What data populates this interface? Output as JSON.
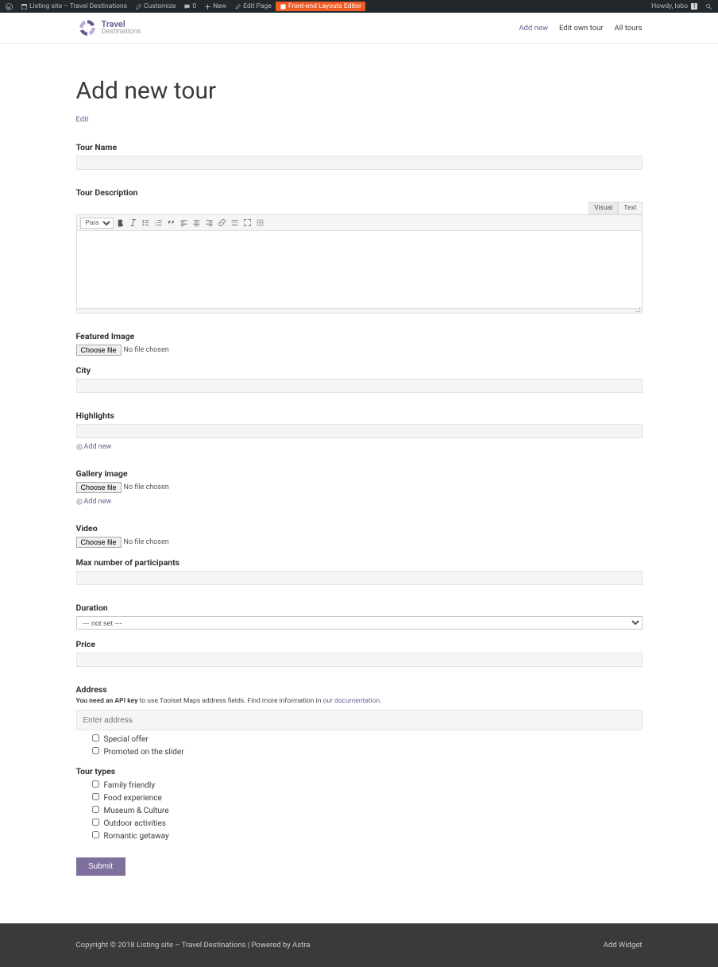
{
  "adminbar": {
    "site": "Listing site – Travel Destinations",
    "customize": "Customize",
    "comments": "0",
    "newlbl": "New",
    "editpage": "Edit Page",
    "fel": "Front-end Layouts Editor",
    "howdy": "Howdy, lobo",
    "avatar_badge": "1"
  },
  "logo": {
    "l1": "Travel",
    "l2": "Destinations"
  },
  "nav": {
    "addnew": "Add new",
    "editown": "Edit own tour",
    "alltours": "All tours"
  },
  "page": {
    "title": "Add new tour",
    "editlink": "Edit"
  },
  "labels": {
    "tourname": "Tour Name",
    "tourdesc": "Tour Description",
    "featured": "Featured Image",
    "city": "City",
    "highlights": "Highlights",
    "gallery": "Gallery image",
    "video": "Video",
    "maxpart": "Max number of participants",
    "duration": "Duration",
    "price": "Price",
    "address": "Address",
    "tourtypes": "Tour types"
  },
  "editor": {
    "tab_visual": "Visual",
    "tab_text": "Text",
    "format": "Paragraph"
  },
  "file": {
    "choose": "Choose file",
    "nofile": "No file chosen"
  },
  "addnew_link": "Add new",
  "duration_value": "--- not set ---",
  "api": {
    "bold": "You need an API key",
    "rest": " to use Toolset Maps address fields. Find more information in ",
    "link": "our documentation"
  },
  "address_placeholder": "Enter address",
  "flags": {
    "special": "Special offer",
    "promoted": "Promoted on the slider"
  },
  "types": {
    "family": "Family friendly",
    "food": "Food experience",
    "museum": "Museum & Culture",
    "outdoor": "Outdoor activities",
    "romantic": "Romantic getaway"
  },
  "submit": "Submit",
  "footer": {
    "copy": "Copyright © 2018 Listing site – Travel Destinations | Powered by Astra",
    "widget": "Add Widget"
  }
}
